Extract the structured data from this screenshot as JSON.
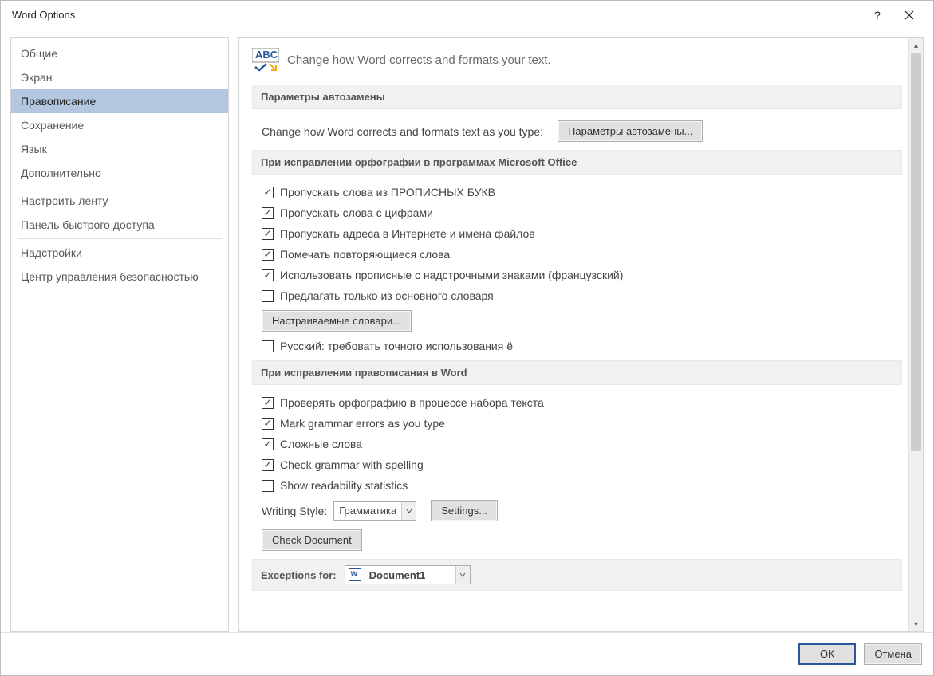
{
  "title": "Word Options",
  "sidebar": {
    "items": [
      {
        "label": "Общие"
      },
      {
        "label": "Экран"
      },
      {
        "label": "Правописание",
        "selected": true
      },
      {
        "label": "Сохранение"
      },
      {
        "label": "Язык"
      },
      {
        "label": "Дополнительно"
      },
      {
        "label": "Настроить ленту"
      },
      {
        "label": "Панель быстрого доступа"
      },
      {
        "label": "Надстройки"
      },
      {
        "label": "Центр управления безопасностью"
      }
    ]
  },
  "header_text": "Change how Word corrects and formats your text.",
  "section1": {
    "title": "Параметры автозамены",
    "desc": "Change how Word corrects and formats text as you type:",
    "btn": "Параметры автозамены..."
  },
  "section2": {
    "title": "При исправлении орфографии в программах Microsoft Office",
    "c1": "Пропускать слова из ПРОПИСНЫХ БУКВ",
    "c2": "Пропускать слова с цифрами",
    "c3": "Пропускать адреса в Интернете и имена файлов",
    "c4": "Помечать повторяющиеся слова",
    "c5": "Использовать прописные с надстрочными знаками (французский)",
    "c6": "Предлагать только из основного словаря",
    "btn": "Настраиваемые словари...",
    "c7": "Русский: требовать точного использования ё"
  },
  "section3": {
    "title": "При исправлении правописания в Word",
    "c1": "Проверять орфографию в процессе набора текста",
    "c2": "Mark grammar errors as you type",
    "c3": "Сложные слова",
    "c4": "Check grammar with spelling",
    "c5": "Show readability statistics",
    "ws_label": "Writing Style:",
    "ws_value": "Грамматика",
    "settings_btn": "Settings...",
    "check_btn": "Check Document"
  },
  "section4": {
    "title": "Exceptions for:",
    "doc": "Document1"
  },
  "footer": {
    "ok": "OK",
    "cancel": "Отмена"
  }
}
